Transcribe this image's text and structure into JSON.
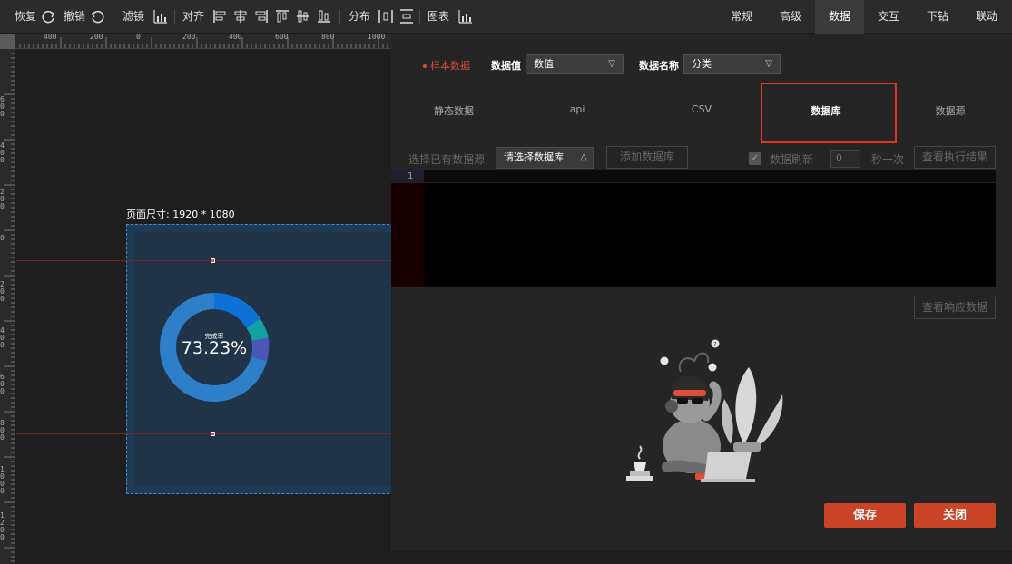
{
  "toolbar": {
    "restore": "恢复",
    "undo": "撤销",
    "filter": "滤镜",
    "align": "对齐",
    "distribute": "分布",
    "chart": "图表"
  },
  "top_tabs": [
    "常规",
    "高级",
    "数据",
    "交互",
    "下钻",
    "联动"
  ],
  "top_tab_active": "数据",
  "canvas": {
    "page_size_label": "页面尺寸: 1920 * 1080",
    "ruler_top": [
      "400",
      "200",
      "0",
      "200",
      "400",
      "600",
      "800",
      "1000"
    ],
    "ruler_left": [
      "600",
      "400",
      "200",
      "0",
      "200",
      "400",
      "600",
      "800",
      "1000",
      "1200"
    ],
    "donut": {
      "label": "完成率",
      "value": "73.23%",
      "colors": [
        "#2f7fc8",
        "#0d72d6",
        "#10a3a0",
        "#4a56b8"
      ]
    }
  },
  "data_panel": {
    "sample_data": "样本数据",
    "value_label": "数据值",
    "value_select": "数值",
    "name_label": "数据名称",
    "name_select": "分类",
    "source_tabs": [
      "静态数据",
      "api",
      "CSV",
      "数据库",
      "数据源"
    ],
    "source_tab_active": "数据库",
    "choose_source_label": "选择已有数据源",
    "db_select": "请选择数据库",
    "add_db_button": "添加数据库",
    "refresh_label": "数据刷新",
    "refresh_value": "0",
    "per_second_label": "秒一次",
    "view_result_button": "查看执行结果",
    "editor_line_number": "1",
    "view_response_button": "查看响应数据",
    "save_button": "保存",
    "close_button": "关闭"
  },
  "colors": {
    "accent_red": "#c94427",
    "highlight_red": "#e2351f",
    "page_blue": "#1f3448"
  }
}
